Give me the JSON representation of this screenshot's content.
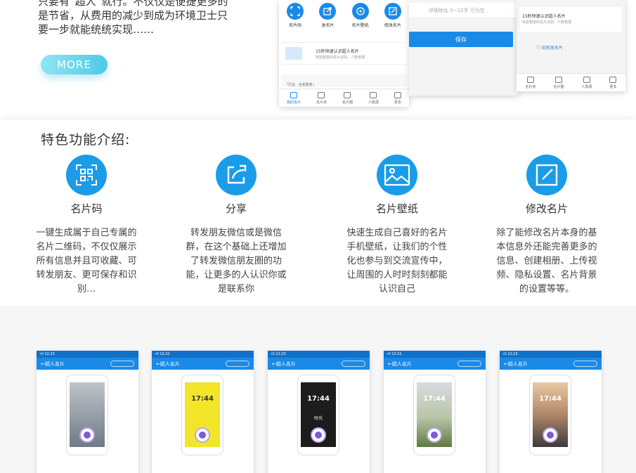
{
  "intro": {
    "line1": "只要有“超人”就行。不仅仅是便捷更多的",
    "line2": "是节省，从费用的减少到成为环境卫士只",
    "line3": "要一步就能统统实现……",
    "more_label": "MORE"
  },
  "top_phones": {
    "a": {
      "actions": [
        "名片码",
        "发名片",
        "名片壁纸",
        "修改名片"
      ],
      "card_title": "15秒快速认识超人名片",
      "card_sub": "体验智能的名片识别、人脉管理",
      "block_text": "「行业 · 全名职务」",
      "tabs": [
        "我的名片",
        "名片夹",
        "名片圈",
        "人脉源",
        "更多"
      ]
    },
    "b": {
      "addr_placeholder": "详细地址 5~12字 可为空",
      "save_label": "保存"
    },
    "c": {
      "card_title": "15秒快速认识超人名片",
      "card_sub": "体验智能的名片识别、人脉管理",
      "howto": "如何发名片",
      "tabs": [
        "名片夹",
        "名片圈",
        "人脉源",
        "更多"
      ]
    }
  },
  "features": {
    "title": "特色功能介绍:",
    "items": [
      {
        "name": "名片码",
        "icon": "qr-code-icon",
        "desc": "一键生成属于自己专属的名片二维码，不仅仅展示所有信息并且可收藏、可转发朋友、更可保存和识别…"
      },
      {
        "name": "分享",
        "icon": "share-icon",
        "desc": "转发朋友微信或是微信群，在这个基础上还增加了转发微信朋友圈的功能，让更多的人认识你或是联系你"
      },
      {
        "name": "名片壁纸",
        "icon": "picture-icon",
        "desc": "快速生成自己喜好的名片手机壁纸，让我们的个性化也参与到交流宣传中，让周围的人时时刻刻都能认识自己"
      },
      {
        "name": "修改名片",
        "icon": "edit-icon",
        "desc": "除了能修改名片本身的基本信息外还能完善更多的信息、创建相册、上传视频、隐私设置、名片背景的设置等等。"
      }
    ]
  },
  "screens": [
    {
      "status": "•ll 12:23",
      "title": "超人名片",
      "time": "",
      "theme": "art"
    },
    {
      "status": "•ll 12:22",
      "title": "超人名片",
      "time": "17:44",
      "theme": "yellow"
    },
    {
      "status": "•ll 12:23",
      "title": "超人名片",
      "time": "17:44",
      "theme": "dark",
      "caption": "时光"
    },
    {
      "status": "•ll 12:21",
      "title": "超人名片",
      "time": "17:44",
      "theme": "field"
    },
    {
      "status": "•ll 12:23",
      "title": "超人名片",
      "time": "17:44",
      "theme": "sunset"
    }
  ],
  "colors": {
    "primary": "#1b8ae6",
    "feature_icon": "#1a9ce8",
    "more_button": "#4fc9e8"
  }
}
